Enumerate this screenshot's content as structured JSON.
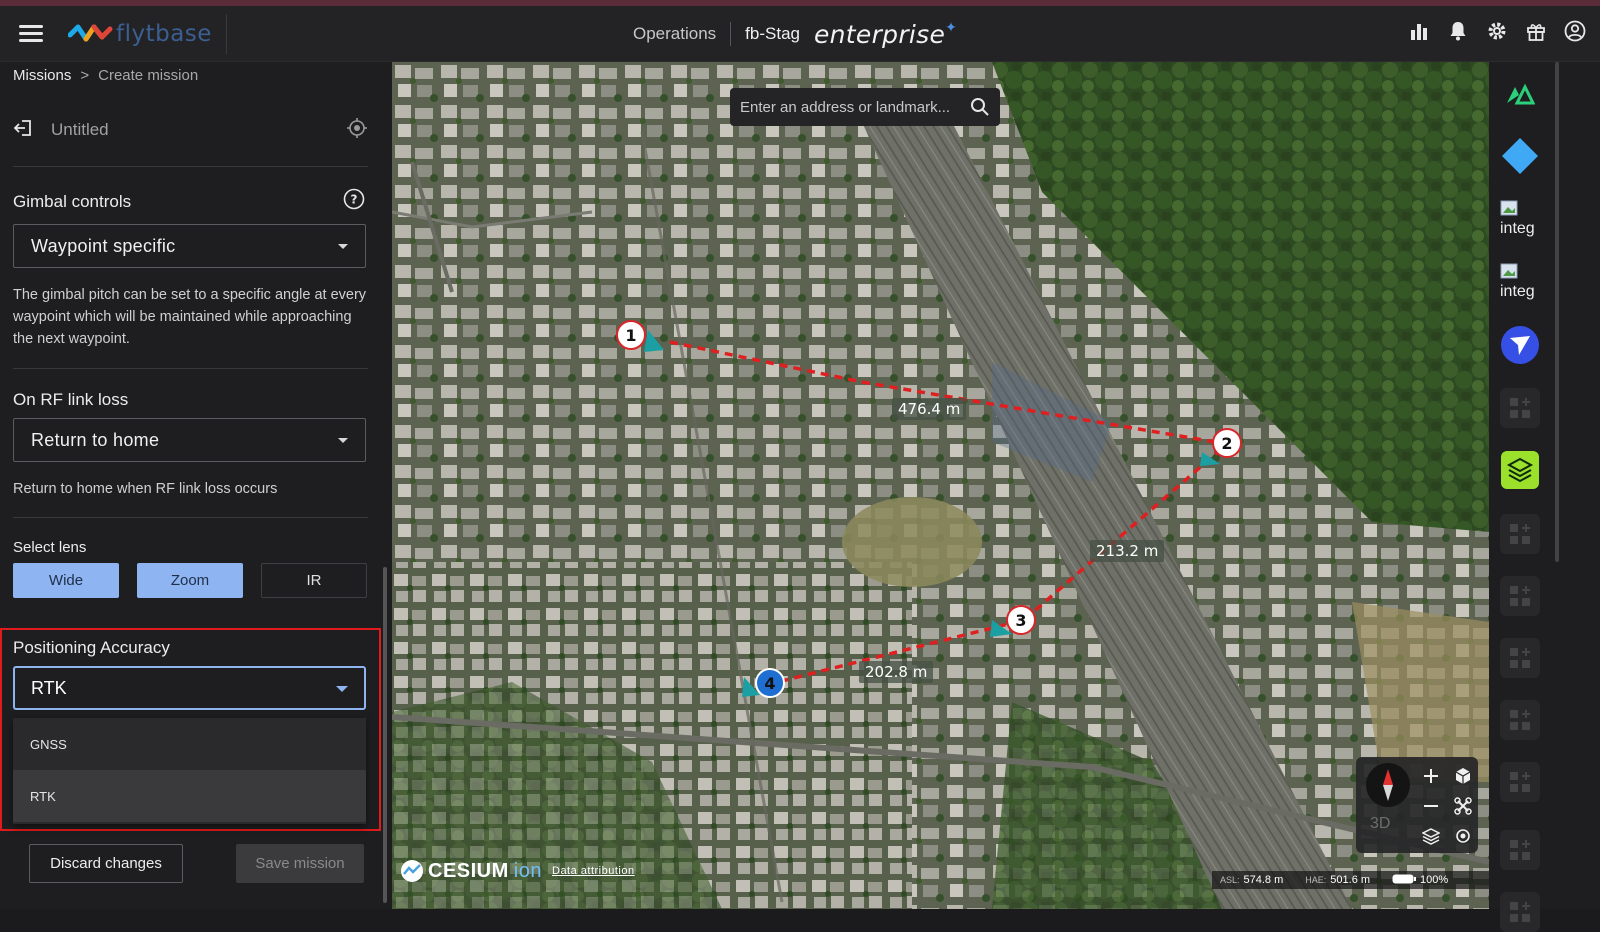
{
  "header": {
    "logo_text": "flytbase",
    "operations_label": "Operations",
    "org_name": "fb-Stag",
    "edition": "enterprise",
    "icons": [
      "analytics-icon",
      "bell-icon",
      "gear-icon",
      "gift-icon",
      "account-icon"
    ]
  },
  "breadcrumb": {
    "parent": "Missions",
    "separator": ">",
    "current": "Create mission"
  },
  "mission": {
    "title": "Untitled"
  },
  "gimbal": {
    "label": "Gimbal controls",
    "value": "Waypoint specific",
    "description": "The gimbal pitch can be set to a specific angle at every waypoint which will be maintained while approaching the next waypoint."
  },
  "rf_link": {
    "label": "On RF link loss",
    "value": "Return to home",
    "description": "Return to home when RF link loss occurs"
  },
  "lens": {
    "label": "Select lens",
    "options": [
      {
        "label": "Wide",
        "selected": true
      },
      {
        "label": "Zoom",
        "selected": true
      },
      {
        "label": "IR",
        "selected": false
      }
    ]
  },
  "positioning": {
    "label": "Positioning Accuracy",
    "value": "RTK",
    "options": [
      "GNSS",
      "RTK"
    ]
  },
  "actions": {
    "discard": "Discard changes",
    "save": "Save mission"
  },
  "map": {
    "search_placeholder": "Enter an address or landmark...",
    "waypoints": [
      "1",
      "2",
      "3",
      "4"
    ],
    "distances": [
      "476.4 m",
      "213.2 m",
      "202.8 m"
    ],
    "view_mode": "3D",
    "attribution_brand": "CESIUM",
    "attribution_ion": "ion",
    "attribution_link": "Data attribution",
    "status": {
      "asl_label": "ASL:",
      "asl_value": "574.8 m",
      "hae_label": "HAE:",
      "hae_value": "501.6 m",
      "zoom": "100%"
    }
  },
  "rightbar": {
    "integration_label_1": "integ",
    "integration_label_2": "integ"
  },
  "colors": {
    "accent": "#8fb4f2",
    "highlight_border": "#e01b1b",
    "waypoint_border": "#d8262a",
    "path": "#e02020"
  }
}
